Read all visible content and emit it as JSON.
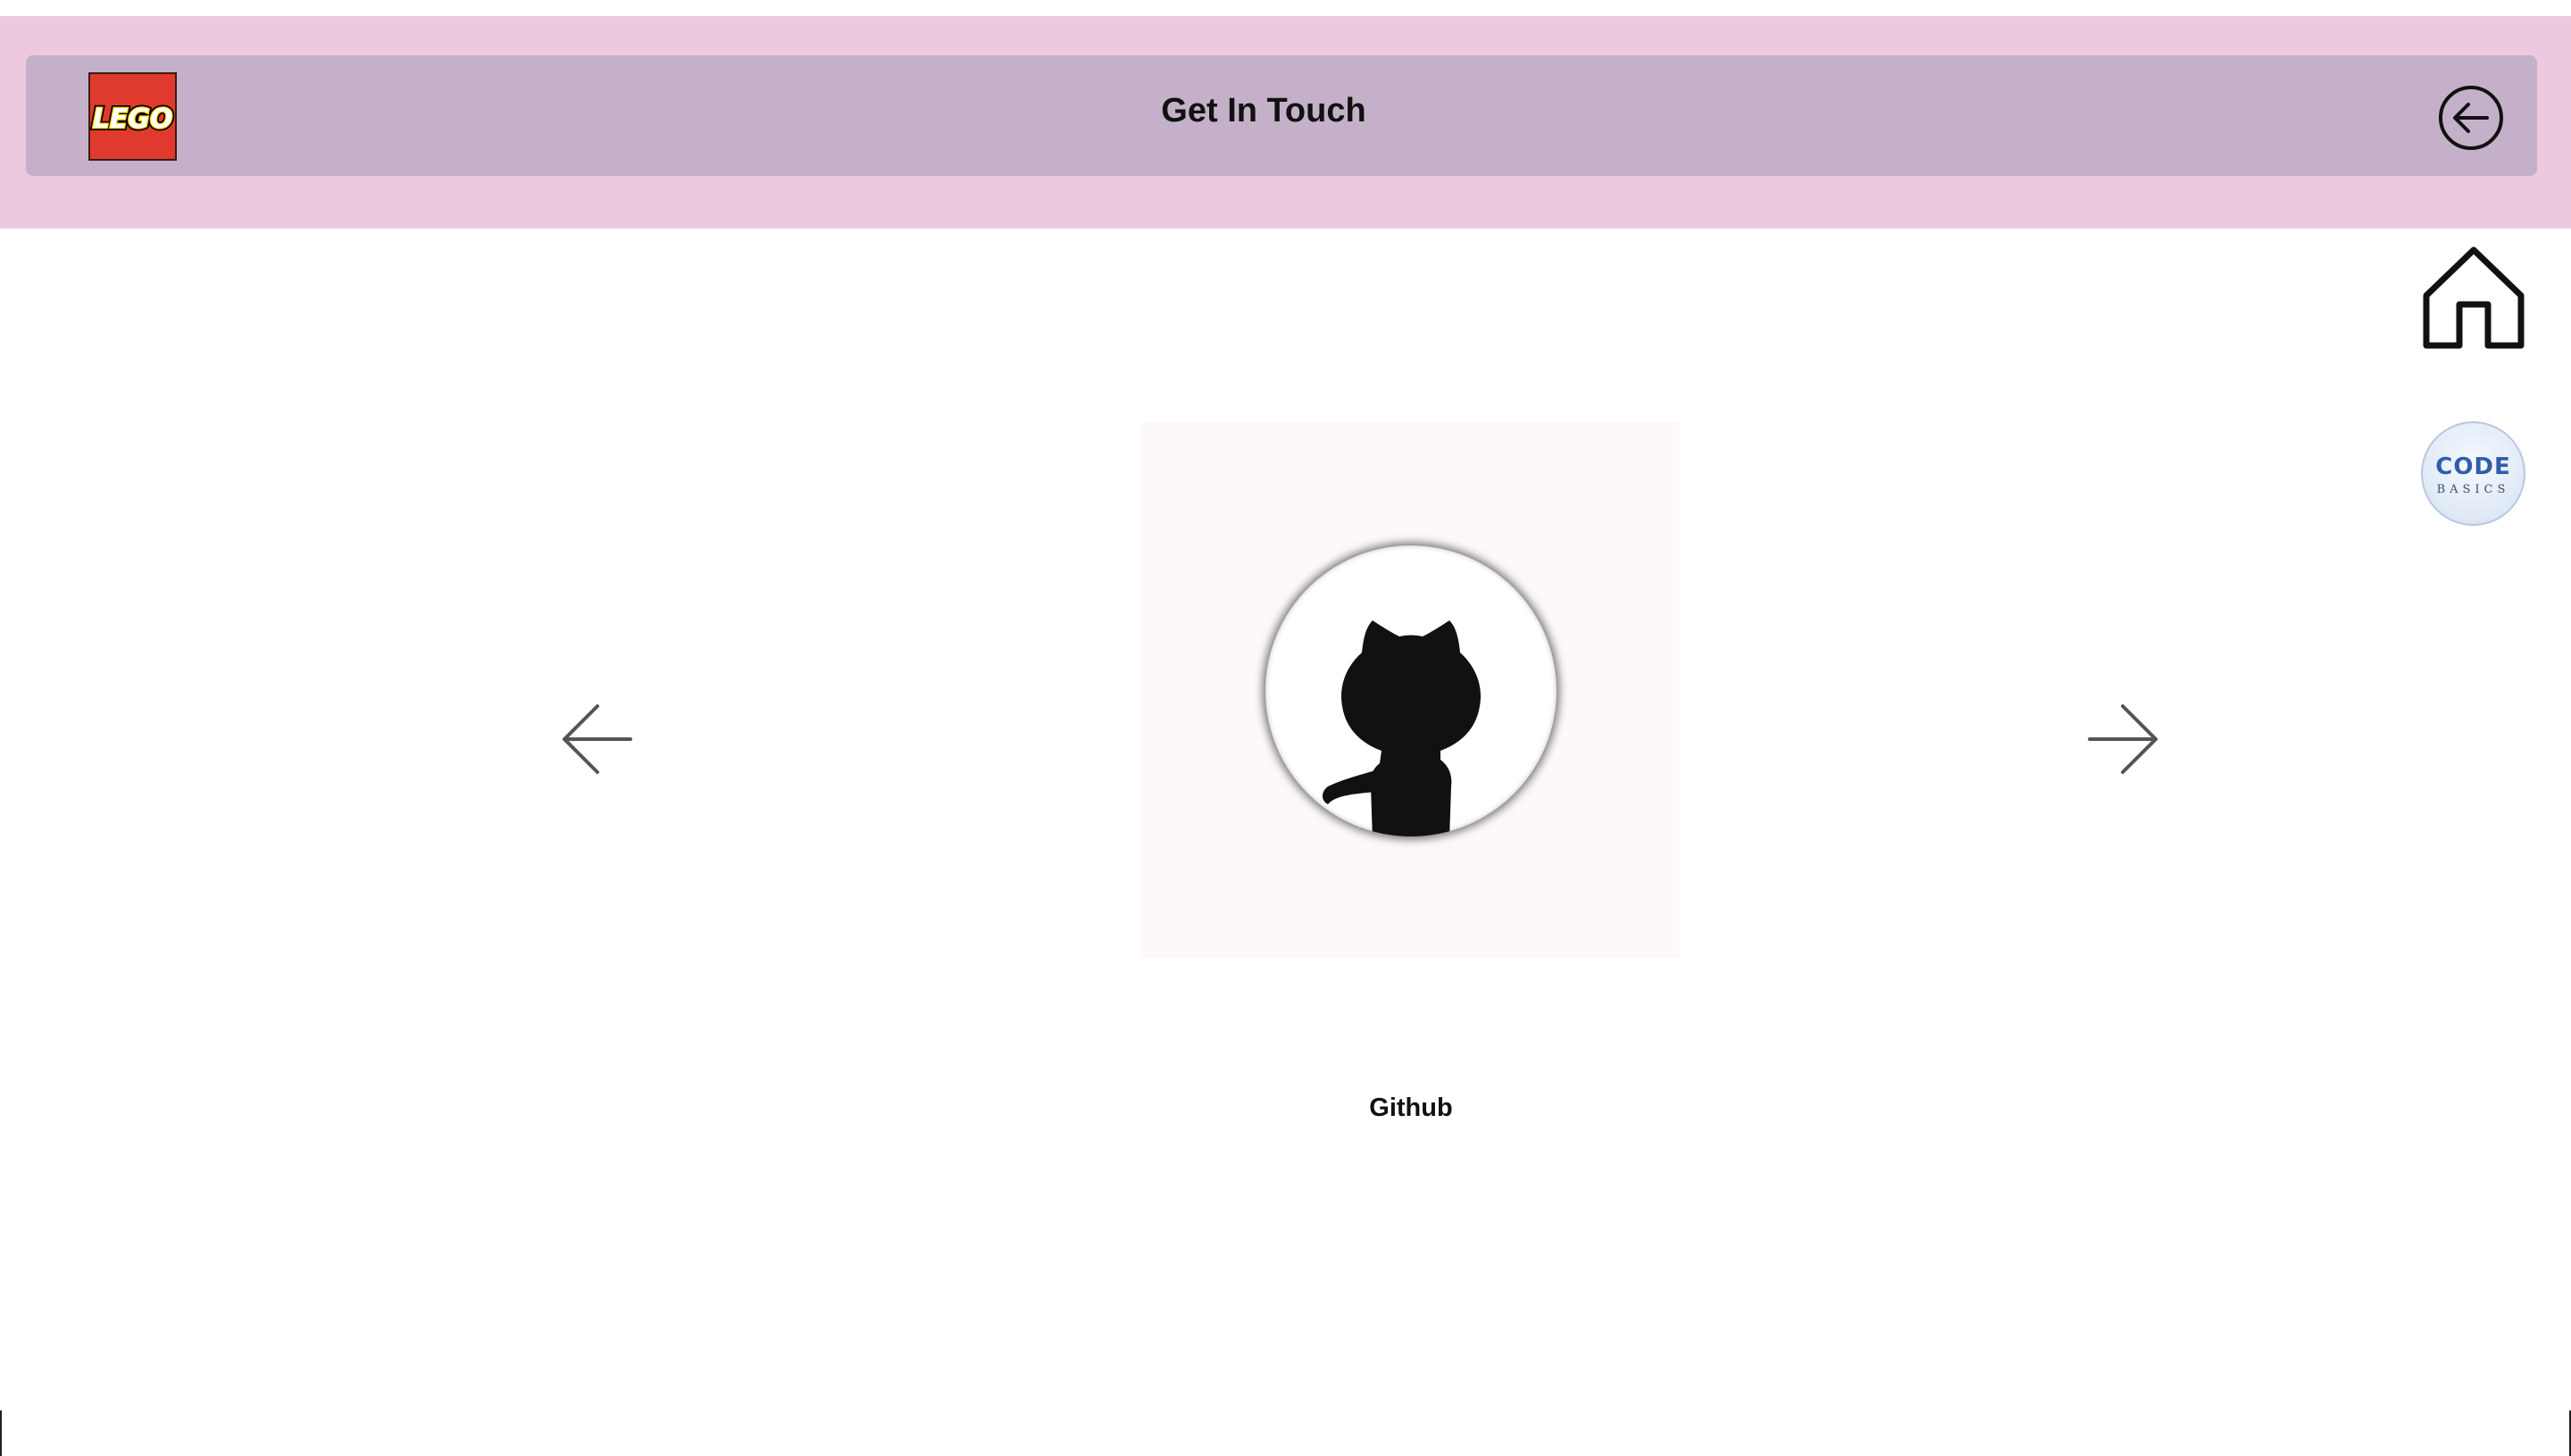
{
  "header": {
    "logo_text": "LEGO",
    "title": "Get In Touch",
    "back_icon": "arrow-left-circle-icon"
  },
  "side_nav": {
    "home_icon": "home-icon",
    "codebasics_logo": {
      "line1": "CODE",
      "line2": "BASICS"
    }
  },
  "carousel": {
    "prev_icon": "arrow-left-icon",
    "next_icon": "arrow-right-icon",
    "current_slide": {
      "icon": "github-octocat-icon",
      "caption": "Github"
    }
  },
  "colors": {
    "top_band": "#ecc9df",
    "header_bar": "#c4b0c8",
    "logo_red": "#e03a2e",
    "logo_yellow": "#ffd400"
  }
}
